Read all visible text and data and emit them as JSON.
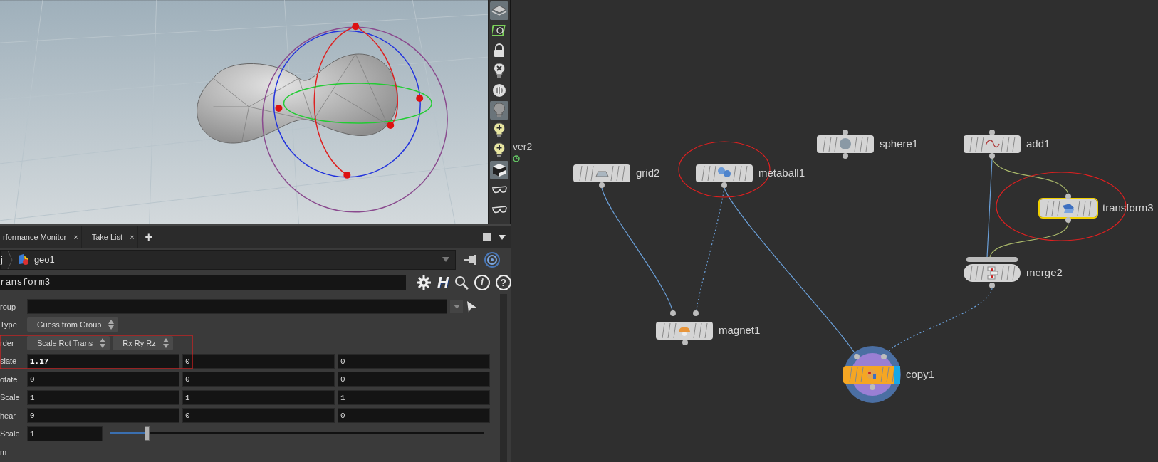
{
  "viewport_tools": [
    {
      "kind": "display",
      "selected": true
    },
    {
      "kind": "snap",
      "selected": false
    },
    {
      "kind": "lock",
      "selected": false
    },
    {
      "kind": "light_off",
      "selected": false
    },
    {
      "kind": "toggle",
      "selected": false
    },
    {
      "kind": "light",
      "selected": true
    },
    {
      "kind": "light_add",
      "selected": false
    },
    {
      "kind": "light_spot",
      "selected": false
    },
    {
      "kind": "shading",
      "selected": true
    },
    {
      "kind": "stereo",
      "selected": false
    },
    {
      "kind": "stereo",
      "selected": false
    }
  ],
  "tabs": [
    {
      "label": "rformance Monitor",
      "close": "×"
    },
    {
      "label": "Take List",
      "close": "×"
    }
  ],
  "add_tab": "+",
  "path": {
    "root": "j",
    "node": "geo1"
  },
  "node_name": "ransform3",
  "name_row_glyphs": {
    "houdini": "H",
    "info": "i",
    "help": "?"
  },
  "parameters": [
    {
      "kind": "text",
      "label": "roup"
    },
    {
      "kind": "select",
      "label": "Type",
      "options": [
        "Guess from Group"
      ]
    },
    {
      "kind": "select",
      "label": "rder",
      "options": [
        "Scale Rot Trans",
        "Rx Ry Rz"
      ]
    },
    {
      "kind": "vector",
      "label": "slate",
      "values": [
        {
          "text": "1.17",
          "modified": true
        },
        {
          "text": "0",
          "modified": false
        },
        {
          "text": "0",
          "modified": false
        }
      ]
    },
    {
      "kind": "vector",
      "label": "otate",
      "values": [
        {
          "text": "0",
          "modified": false
        },
        {
          "text": "0",
          "modified": false
        },
        {
          "text": "0",
          "modified": false
        }
      ]
    },
    {
      "kind": "vector",
      "label": "Scale",
      "values": [
        {
          "text": "1",
          "modified": false
        },
        {
          "text": "1",
          "modified": false
        },
        {
          "text": "1",
          "modified": false
        }
      ]
    },
    {
      "kind": "vector",
      "label": "hear",
      "values": [
        {
          "text": "0",
          "modified": false
        },
        {
          "text": "0",
          "modified": false
        },
        {
          "text": "0",
          "modified": false
        }
      ]
    },
    {
      "kind": "slider",
      "label": "Scale",
      "value": "1",
      "level": 0.1
    },
    {
      "kind": "heading",
      "label": "m"
    }
  ],
  "network": {
    "partial_label": "ver2",
    "nodes": [
      {
        "name": "sphere1",
        "kind": "sphere",
        "selected": false,
        "display_flag": false
      },
      {
        "name": "add1",
        "kind": "add",
        "selected": false,
        "display_flag": false
      },
      {
        "name": "grid2",
        "kind": "grid",
        "selected": false,
        "display_flag": false
      },
      {
        "name": "metaball1",
        "kind": "metaball",
        "selected": false,
        "display_flag": false
      },
      {
        "name": "transform3",
        "kind": "transform",
        "selected": true,
        "display_flag": false
      },
      {
        "name": "merge2",
        "kind": "merge",
        "selected": false,
        "display_flag": false
      },
      {
        "name": "magnet1",
        "kind": "magnet",
        "selected": false,
        "display_flag": false
      },
      {
        "name": "copy1",
        "kind": "copy",
        "selected": false,
        "display_flag": true
      }
    ]
  }
}
